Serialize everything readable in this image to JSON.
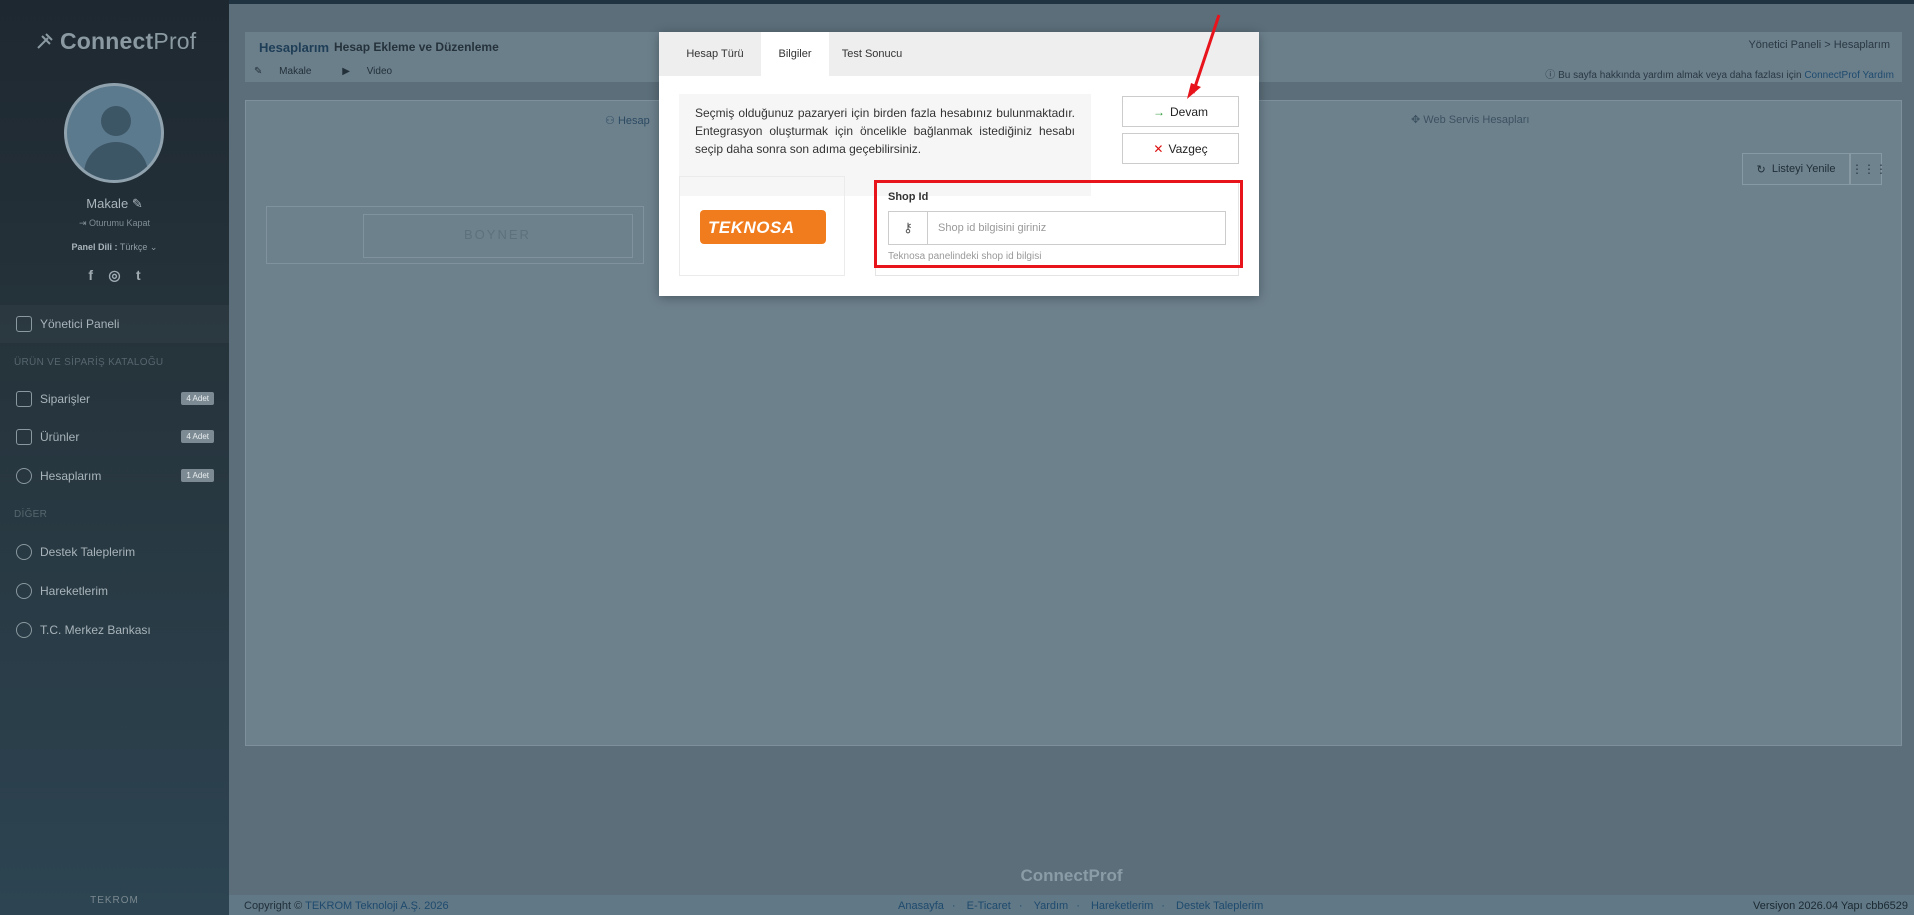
{
  "brand": {
    "bold": "Connect",
    "light": "Prof"
  },
  "user": {
    "name": "Makale",
    "logout": "Oturumu Kapat",
    "lang_label": "Panel Dili :",
    "lang_value": "Türkçe"
  },
  "socials": [
    "f",
    "◎",
    "t"
  ],
  "nav": {
    "dashboard": "Yönetici Paneli",
    "section1": "ÜRÜN VE SİPARİŞ KATALOĞU",
    "orders": "Siparişler",
    "orders_badge": "4 Adet",
    "products": "Ürünler",
    "products_badge": "4 Adet",
    "accounts": "Hesaplarım",
    "accounts_badge": "1 Adet",
    "section2": "DİĞER",
    "support": "Destek Taleplerim",
    "activity": "Hareketlerim",
    "bank": "T.C. Merkez Bankası"
  },
  "sidebar_footer": "TEKROM",
  "page": {
    "title": "Hesaplarım",
    "subtitle": "Hesap Ekleme ve Düzenleme",
    "link_article": "Makale",
    "link_video": "Video",
    "breadcrumb": "Yönetici Paneli  >  Hesaplarım",
    "help_text": "Bu sayfa hakkında yardım almak veya daha fazlası için",
    "help_link": "ConnectProf Yardım",
    "tab_left": "Hesap",
    "tab_right": "Web Servis Hesapları",
    "refresh": "Listeyi Yenile",
    "strip_text": "BOYNER"
  },
  "modal": {
    "tabs": [
      "Hesap Türü",
      "Bilgiler",
      "Test Sonucu"
    ],
    "active_tab": 1,
    "info": "Seçmiş olduğunuz pazaryeri için birden fazla hesabınız bulunmaktadır. Entegrasyon oluşturmak için öncelikle bağlanmak istediğiniz hesabı seçip daha sonra son adıma geçebilirsiniz.",
    "continue": "Devam",
    "cancel": "Vazgeç",
    "marketplace_logo": "TEKNOSA",
    "field_label": "Shop Id",
    "field_placeholder": "Shop id bilgisini giriniz",
    "field_value": "",
    "field_hint": "Teknosa panelindeki shop id bilgisi"
  },
  "footer": {
    "brand": "ConnectProf",
    "copyright": "Copyright ©",
    "company": "TEKROM Teknoloji A.Ş. 2026",
    "links": [
      "Anasayfa",
      "E-Ticaret",
      "Yardım",
      "Hareketlerim",
      "Destek Taleplerim"
    ],
    "version": "Versiyon 2026.04 Yapı cbb6529"
  },
  "colors": {
    "highlight": "#e8141c",
    "teknosa_orange": "#f07c1e",
    "arrow": "#e8141c"
  }
}
